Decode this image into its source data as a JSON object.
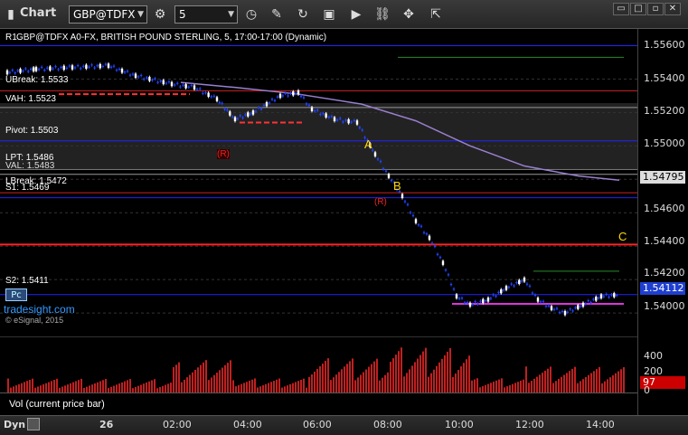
{
  "toolbar": {
    "app_title": "Chart",
    "symbol": "GBP@TDFX",
    "interval": "5",
    "tool_icons": [
      "clock-icon",
      "pen-icon",
      "refresh-icon",
      "gear-box-icon",
      "play-icon",
      "link-icon",
      "export-icon"
    ]
  },
  "chart_header": "GBP@TDFX A0-FX, BRITISH POUND STERLING, 5, 17:00-17:00 (Dynamic)",
  "chart_header_prefix": "R1",
  "chart_data": {
    "type": "candlestick",
    "yticks": [
      "1.55600",
      "1.55400",
      "1.55200",
      "1.55000",
      "1.54800",
      "1.54600",
      "1.54400",
      "1.54200",
      "1.54000"
    ],
    "ylim": [
      1.5386,
      1.557
    ],
    "xticks": [
      "26",
      "02:00",
      "04:00",
      "06:00",
      "08:00",
      "10:00",
      "12:00",
      "14:00"
    ],
    "last_price": "1.54112",
    "highlight_price": "1.54795",
    "levels": [
      {
        "name": "R1",
        "text": "R1 1.5560"
      },
      {
        "name": "UBreak",
        "text": "UBreak: 1.5533"
      },
      {
        "name": "VAH",
        "text": "VAH: 1.5523"
      },
      {
        "name": "Pivot",
        "text": "Pivot: 1.5503"
      },
      {
        "name": "LPT",
        "text": "LPT: 1.5486"
      },
      {
        "name": "VAL",
        "text": "VAL: 1.5483"
      },
      {
        "name": "LBreak",
        "text": "LBreak: 1.5472"
      },
      {
        "name": "S1",
        "text": "S1: 1.5469"
      },
      {
        "name": "S2",
        "text": "S2: 1.5411"
      }
    ],
    "annotations": [
      "A",
      "B",
      "C",
      "(R)",
      "(R)"
    ]
  },
  "watermark": {
    "brand": "tradesight.com",
    "copyright": "© eSignal, 2015"
  },
  "pc_label": "Pc",
  "volume": {
    "label": "Vol (current price bar)",
    "ticks": [
      "400",
      "200",
      "0"
    ],
    "current": "97"
  },
  "footer_left": "Dyn"
}
